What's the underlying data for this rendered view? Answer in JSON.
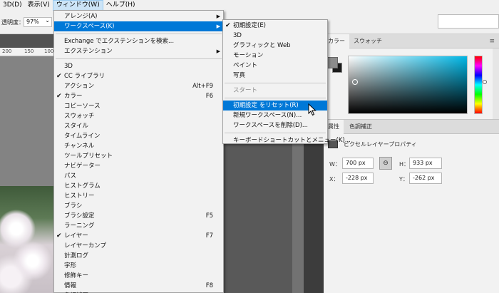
{
  "menubar": [
    "3D(D)",
    "表示(V)",
    "ウィンドウ(W)",
    "ヘルプ(H)"
  ],
  "options": {
    "opacity_label": "透明度：",
    "opacity_value": "97%",
    "opacity_arrow": "⌄"
  },
  "ruler": [
    "200",
    "150",
    "100"
  ],
  "window_menu": [
    {
      "label": "アレンジ(A)",
      "arrow": true
    },
    {
      "label": "ワークスペース(K)",
      "arrow": true,
      "highlight": true
    },
    {
      "sep": true
    },
    {
      "label": "Exchange でエクステンションを検索..."
    },
    {
      "label": "エクステンション",
      "arrow": true
    },
    {
      "sep": true
    },
    {
      "label": "3D"
    },
    {
      "label": "CC ライブラリ",
      "check": true
    },
    {
      "label": "アクション",
      "shortcut": "Alt+F9"
    },
    {
      "label": "カラー",
      "check": true,
      "shortcut": "F6"
    },
    {
      "label": "コピーソース"
    },
    {
      "label": "スウォッチ"
    },
    {
      "label": "スタイル"
    },
    {
      "label": "タイムライン"
    },
    {
      "label": "チャンネル"
    },
    {
      "label": "ツールプリセット"
    },
    {
      "label": "ナビゲーター"
    },
    {
      "label": "パス"
    },
    {
      "label": "ヒストグラム"
    },
    {
      "label": "ヒストリー"
    },
    {
      "label": "ブラシ"
    },
    {
      "label": "ブラシ設定",
      "shortcut": "F5"
    },
    {
      "label": "ラーニング"
    },
    {
      "label": "レイヤー",
      "check": true,
      "shortcut": "F7"
    },
    {
      "label": "レイヤーカンプ"
    },
    {
      "label": "計測ログ"
    },
    {
      "label": "字形"
    },
    {
      "label": "修飾キー"
    },
    {
      "label": "情報",
      "shortcut": "F8"
    },
    {
      "label": "色調補正"
    }
  ],
  "workspace_menu": [
    {
      "label": "初期設定(E)",
      "check": true
    },
    {
      "label": "3D"
    },
    {
      "label": "グラフィックと Web"
    },
    {
      "label": "モーション"
    },
    {
      "label": "ペイント"
    },
    {
      "label": "写真"
    },
    {
      "sep": true
    },
    {
      "label": "スタート",
      "disabled": true
    },
    {
      "sep": true
    },
    {
      "label": "初期設定 をリセット(R)",
      "highlight": true
    },
    {
      "label": "新規ワークスペース(N)..."
    },
    {
      "label": "ワークスペースを削除(D)..."
    },
    {
      "sep": true
    },
    {
      "label": "キーボードショートカットとメニュー(K)..."
    }
  ],
  "color_panel": {
    "tabs": [
      "カラー",
      "スウォッチ"
    ],
    "menu_icon": "≡",
    "fg_color": "#8c8c8c",
    "bg_color": "#1a1a1a"
  },
  "properties_panel": {
    "tabs": [
      "属性",
      "色調補正"
    ],
    "title": "ピクセルレイヤープロパティ",
    "w_label": "W：",
    "w_value": "700 px",
    "h_label": "H：",
    "h_value": "933 px",
    "x_label": "X：",
    "x_value": "-228 px",
    "y_label": "Y：",
    "y_value": "-262 px",
    "link_icon": "⊖"
  }
}
